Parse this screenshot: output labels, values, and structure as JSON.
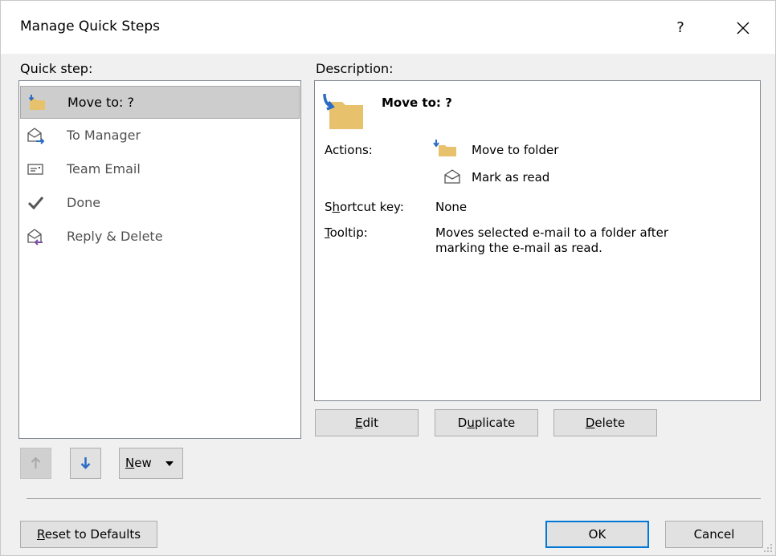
{
  "window": {
    "title": "Manage Quick Steps",
    "help": "?"
  },
  "quick_step_label": "Quick step:",
  "description_label": "Description:",
  "quick_steps": [
    {
      "label": "Move to: ?",
      "icon": "folder-move-icon",
      "selected": true
    },
    {
      "label": "To Manager",
      "icon": "envelope-forward-icon",
      "selected": false
    },
    {
      "label": "Team Email",
      "icon": "email-card-icon",
      "selected": false
    },
    {
      "label": "Done",
      "icon": "checkmark-icon",
      "selected": false
    },
    {
      "label": "Reply & Delete",
      "icon": "envelope-reply-icon",
      "selected": false
    }
  ],
  "description": {
    "title": "Move to: ?",
    "actions_label": "Actions:",
    "actions": [
      {
        "label": "Move to folder",
        "icon": "folder-move-icon"
      },
      {
        "label": "Mark as read",
        "icon": "open-envelope-icon"
      }
    ],
    "shortcut_label_pre": "S",
    "shortcut_label_u": "h",
    "shortcut_label_post": "ortcut key:",
    "shortcut_value": "None",
    "tooltip_label_u": "T",
    "tooltip_label_post": "ooltip:",
    "tooltip_line1": "Moves selected e-mail to a folder after",
    "tooltip_line2": "marking the e-mail as read."
  },
  "buttons": {
    "edit_u": "E",
    "edit_rest": "dit",
    "duplicate_pre": "D",
    "duplicate_u": "u",
    "duplicate_rest": "plicate",
    "delete_u": "D",
    "delete_rest": "elete",
    "new_u": "N",
    "new_rest": "ew",
    "reset_u": "R",
    "reset_rest": "eset to Defaults",
    "ok": "OK",
    "cancel": "Cancel"
  },
  "colors": {
    "accent": "#0078d7",
    "folder": "#e8c16c",
    "arrow_blue": "#2b6cc4",
    "reply_purple": "#7b4fa8"
  }
}
